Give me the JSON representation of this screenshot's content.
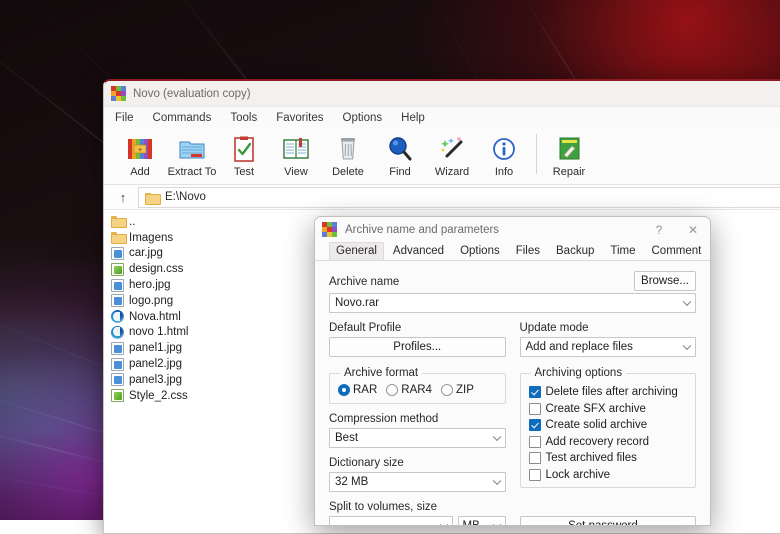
{
  "desktop": {
    "wallpaper_colors": [
      "#0a0607",
      "#a51216",
      "#961ea0",
      "#14dcc8",
      "#c8cdd7"
    ]
  },
  "main_window": {
    "title": "Novo (evaluation copy)",
    "menu": [
      "File",
      "Commands",
      "Tools",
      "Favorites",
      "Options",
      "Help"
    ],
    "toolbar": [
      {
        "label": "Add",
        "icon": "add-archive-icon"
      },
      {
        "label": "Extract To",
        "icon": "extract-folder-icon"
      },
      {
        "label": "Test",
        "icon": "test-clipboard-icon"
      },
      {
        "label": "View",
        "icon": "view-book-icon"
      },
      {
        "label": "Delete",
        "icon": "delete-trash-icon"
      },
      {
        "label": "Find",
        "icon": "find-magnifier-icon"
      },
      {
        "label": "Wizard",
        "icon": "wizard-wand-icon"
      },
      {
        "label": "Info",
        "icon": "info-circle-icon"
      },
      {
        "label": "Repair",
        "icon": "repair-book-icon"
      }
    ],
    "address": {
      "path": "E:\\Novo",
      "up_glyph": "↑"
    },
    "files": [
      {
        "name": "..",
        "icon": "folder-icon"
      },
      {
        "name": "Imagens",
        "icon": "folder-icon"
      },
      {
        "name": "car.jpg",
        "icon": "jpg-file-icon"
      },
      {
        "name": "design.css",
        "icon": "css-file-icon"
      },
      {
        "name": "hero.jpg",
        "icon": "jpg-file-icon"
      },
      {
        "name": "logo.png",
        "icon": "png-file-icon"
      },
      {
        "name": "Nova.html",
        "icon": "edge-html-icon"
      },
      {
        "name": "novo 1.html",
        "icon": "edge-html-icon"
      },
      {
        "name": "panel1.jpg",
        "icon": "jpg-file-icon"
      },
      {
        "name": "panel2.jpg",
        "icon": "jpg-file-icon"
      },
      {
        "name": "panel3.jpg",
        "icon": "jpg-file-icon"
      },
      {
        "name": "Style_2.css",
        "icon": "css-file-icon"
      }
    ]
  },
  "dialog": {
    "title": "Archive name and parameters",
    "help_glyph": "?",
    "close_glyph": "✕",
    "tabs": [
      {
        "label": "General",
        "active": true
      },
      {
        "label": "Advanced",
        "active": false
      },
      {
        "label": "Options",
        "active": false
      },
      {
        "label": "Files",
        "active": false
      },
      {
        "label": "Backup",
        "active": false
      },
      {
        "label": "Time",
        "active": false
      },
      {
        "label": "Comment",
        "active": false
      }
    ],
    "archive_name": {
      "label": "Archive name",
      "value": "Novo.rar",
      "browse_label": "Browse..."
    },
    "profile": {
      "label": "Default Profile",
      "button_label": "Profiles..."
    },
    "update_mode": {
      "label": "Update mode",
      "value": "Add and replace files"
    },
    "archive_format": {
      "legend": "Archive format",
      "options": [
        {
          "label": "RAR",
          "selected": true
        },
        {
          "label": "RAR4",
          "selected": false
        },
        {
          "label": "ZIP",
          "selected": false
        }
      ]
    },
    "compression_method": {
      "label": "Compression method",
      "value": "Best"
    },
    "dictionary_size": {
      "label": "Dictionary size",
      "value": "32 MB"
    },
    "archiving_options": {
      "legend": "Archiving options",
      "items": [
        {
          "label": "Delete files after archiving",
          "checked": true
        },
        {
          "label": "Create SFX archive",
          "checked": false
        },
        {
          "label": "Create solid archive",
          "checked": true
        },
        {
          "label": "Add recovery record",
          "checked": false
        },
        {
          "label": "Test archived files",
          "checked": false
        },
        {
          "label": "Lock archive",
          "checked": false
        }
      ]
    },
    "split_volumes": {
      "label": "Split to volumes, size",
      "value": "",
      "unit": "MB"
    },
    "set_password": {
      "label": "Set password..."
    }
  }
}
